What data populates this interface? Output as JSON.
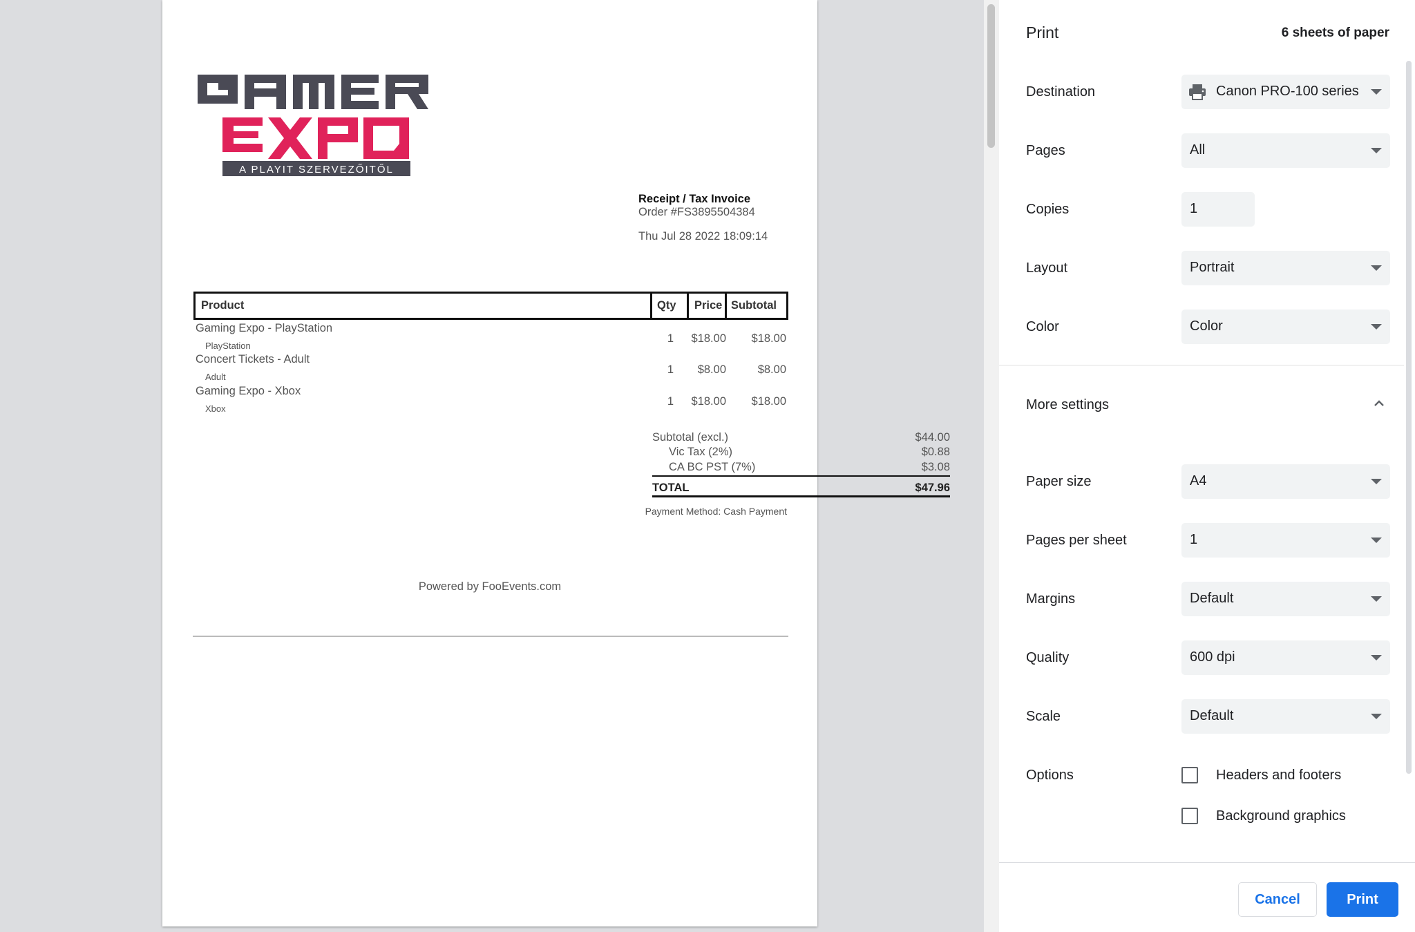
{
  "receipt": {
    "logo": {
      "line1": "GAMER",
      "line2": "EXPO",
      "tagline": "A PLAYIT SZERVEZŐITŐL",
      "dark_color": "#4a4a55",
      "accent_color": "#e0225a"
    },
    "title": "Receipt / Tax Invoice",
    "order": "Order #FS3895504384",
    "date": "Thu Jul 28 2022 18:09:14",
    "columns": [
      "Product",
      "Qty",
      "Price",
      "Subtotal"
    ],
    "items": [
      {
        "name": "Gaming Expo - PlayStation",
        "variant": "PlayStation",
        "qty": "1",
        "price": "$18.00",
        "subtotal": "$18.00"
      },
      {
        "name": "Concert Tickets - Adult",
        "variant": "Adult",
        "qty": "1",
        "price": "$8.00",
        "subtotal": "$8.00"
      },
      {
        "name": "Gaming Expo - Xbox",
        "variant": "Xbox",
        "qty": "1",
        "price": "$18.00",
        "subtotal": "$18.00"
      }
    ],
    "totals": {
      "subtotal_label": "Subtotal (excl.)",
      "subtotal_value": "$44.00",
      "tax1_label": "Vic Tax (2%)",
      "tax1_value": "$0.88",
      "tax2_label": "CA BC PST (7%)",
      "tax2_value": "$3.08",
      "total_label": "TOTAL",
      "total_value": "$47.96"
    },
    "payment_method": "Payment Method: Cash Payment",
    "powered_by": "Powered by FooEvents.com"
  },
  "print_panel": {
    "title": "Print",
    "sheets": "6 sheets of paper",
    "destination": {
      "label": "Destination",
      "value": "Canon PRO-100 series"
    },
    "pages": {
      "label": "Pages",
      "value": "All"
    },
    "copies": {
      "label": "Copies",
      "value": "1"
    },
    "layout": {
      "label": "Layout",
      "value": "Portrait"
    },
    "color": {
      "label": "Color",
      "value": "Color"
    },
    "more_settings": "More settings",
    "paper_size": {
      "label": "Paper size",
      "value": "A4"
    },
    "pages_per_sheet": {
      "label": "Pages per sheet",
      "value": "1"
    },
    "margins": {
      "label": "Margins",
      "value": "Default"
    },
    "quality": {
      "label": "Quality",
      "value": "600 dpi"
    },
    "scale": {
      "label": "Scale",
      "value": "Default"
    },
    "options": {
      "label": "Options",
      "headers_footers": {
        "label": "Headers and footers",
        "checked": false
      },
      "background_graphics": {
        "label": "Background graphics",
        "checked": false
      }
    },
    "cancel": "Cancel",
    "print": "Print",
    "accent_color": "#1a73e8"
  }
}
